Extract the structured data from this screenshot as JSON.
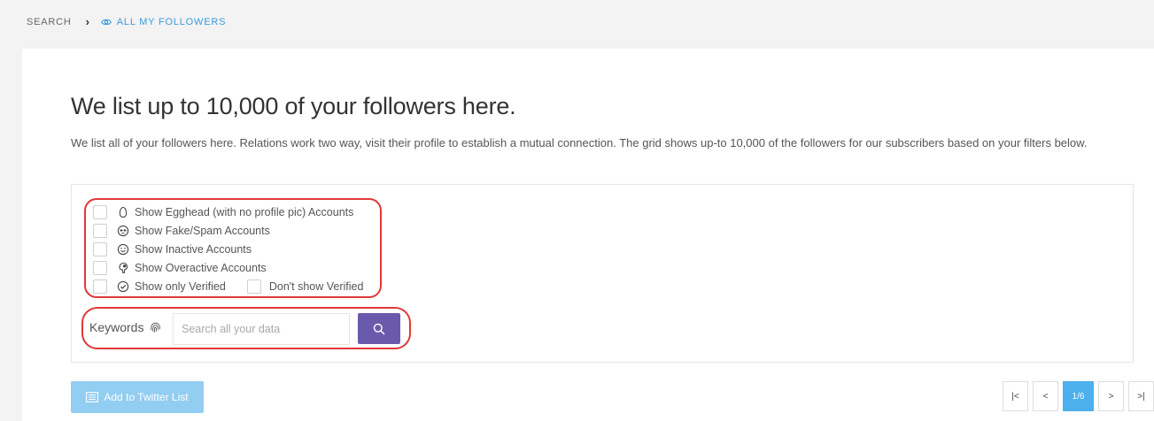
{
  "breadcrumb": {
    "root": "SEARCH",
    "separator": "›",
    "current": "ALL MY FOLLOWERS",
    "current_icon": "eye-icon"
  },
  "page": {
    "title": "We list up to 10,000 of your followers here.",
    "description": "We list all of your followers here. Relations work two way, visit their profile to establish a mutual connection. The grid shows up-to 10,000 of the followers for our subscribers based on your filters below."
  },
  "filters": [
    {
      "label": "Show Egghead (with no profile pic) Accounts",
      "icon": "egg-icon",
      "checked": false
    },
    {
      "label": "Show Fake/Spam Accounts",
      "icon": "alien-icon",
      "checked": false
    },
    {
      "label": "Show Inactive Accounts",
      "icon": "smile-icon",
      "checked": false
    },
    {
      "label": "Show Overactive Accounts",
      "icon": "parrot-icon",
      "checked": false
    },
    {
      "label": "Show only Verified",
      "icon": "verified-check-icon",
      "checked": false
    }
  ],
  "dont_show_verified": {
    "label": "Don't show Verified",
    "checked": false
  },
  "search": {
    "label": "Keywords",
    "label_icon": "fingerprint-icon",
    "placeholder": "Search all your data",
    "value": "",
    "button_icon": "search-icon"
  },
  "actions": {
    "add_list_label": "Add to Twitter List",
    "add_list_icon": "list-icon"
  },
  "pagination": {
    "first": "|<",
    "prev": "<",
    "current": "1/6",
    "next": ">",
    "last": ">|"
  },
  "colors": {
    "accent_link": "#3a9bd9",
    "search_button": "#6a5aab",
    "add_list_button": "#92cdf2",
    "page_active": "#4bb0ec",
    "highlight": "#e0383a"
  }
}
